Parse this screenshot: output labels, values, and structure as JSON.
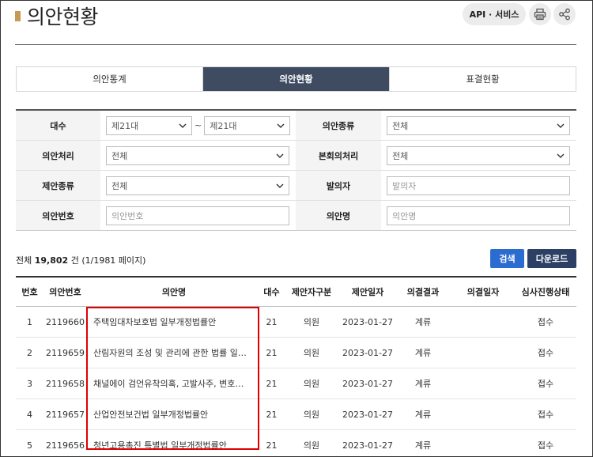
{
  "header": {
    "title": "의안현황",
    "api_label": "API · 서비스",
    "print_icon": "printer-icon",
    "share_icon": "share-icon"
  },
  "tabs": [
    {
      "label": "의안통계",
      "active": false
    },
    {
      "label": "의안현황",
      "active": true
    },
    {
      "label": "표결현황",
      "active": false
    }
  ],
  "form": {
    "session": {
      "label": "대수",
      "from": "제21대",
      "to": "제21대",
      "separator": "~"
    },
    "bill_type": {
      "label": "의안종류",
      "value": "전체"
    },
    "processing": {
      "label": "의안처리",
      "value": "전체"
    },
    "plenary": {
      "label": "본회의처리",
      "value": "전체"
    },
    "proposal_type": {
      "label": "제안종류",
      "value": "전체"
    },
    "proposer": {
      "label": "발의자",
      "placeholder": "발의자"
    },
    "bill_no": {
      "label": "의안번호",
      "placeholder": "의안번호"
    },
    "bill_name": {
      "label": "의안명",
      "placeholder": "의안명"
    }
  },
  "summary": {
    "prefix": "전체",
    "count": "19,802",
    "suffix": "건 (1/1981 페이지)"
  },
  "buttons": {
    "search": "검색",
    "download": "다운로드"
  },
  "table": {
    "headers": [
      "번호",
      "의안번호",
      "의안명",
      "대수",
      "제안자구분",
      "제안일자",
      "의결결과",
      "의결일자",
      "심사진행상태"
    ],
    "rows": [
      {
        "no": "1",
        "bill_no": "2119660",
        "name": "주택임대차보호법 일부개정법률안",
        "session": "21",
        "proposer_type": "의원",
        "date": "2023-01-27",
        "result": "계류",
        "decision_date": "",
        "status": "접수"
      },
      {
        "no": "2",
        "bill_no": "2119659",
        "name": "산림자원의 조성 및 관리에 관한 법률 일부...",
        "session": "21",
        "proposer_type": "의원",
        "date": "2023-01-27",
        "result": "계류",
        "decision_date": "",
        "status": "접수"
      },
      {
        "no": "3",
        "bill_no": "2119658",
        "name": "채널에이 검언유착의혹, 고발사주, 변호문건...",
        "session": "21",
        "proposer_type": "의원",
        "date": "2023-01-27",
        "result": "계류",
        "decision_date": "",
        "status": "접수"
      },
      {
        "no": "4",
        "bill_no": "2119657",
        "name": "산업안전보건법 일부개정법률안",
        "session": "21",
        "proposer_type": "의원",
        "date": "2023-01-27",
        "result": "계류",
        "decision_date": "",
        "status": "접수"
      },
      {
        "no": "5",
        "bill_no": "2119656",
        "name": "청년고용촉진 특별법 일부개정법률안",
        "session": "21",
        "proposer_type": "의원",
        "date": "2023-01-27",
        "result": "계류",
        "decision_date": "",
        "status": "접수"
      }
    ]
  },
  "colors": {
    "active_tab": "#3e4b61",
    "search_button": "#2b6cd0",
    "download_button": "#2c3f64",
    "title_accent": "#c69a52",
    "highlight": "#e00000"
  }
}
